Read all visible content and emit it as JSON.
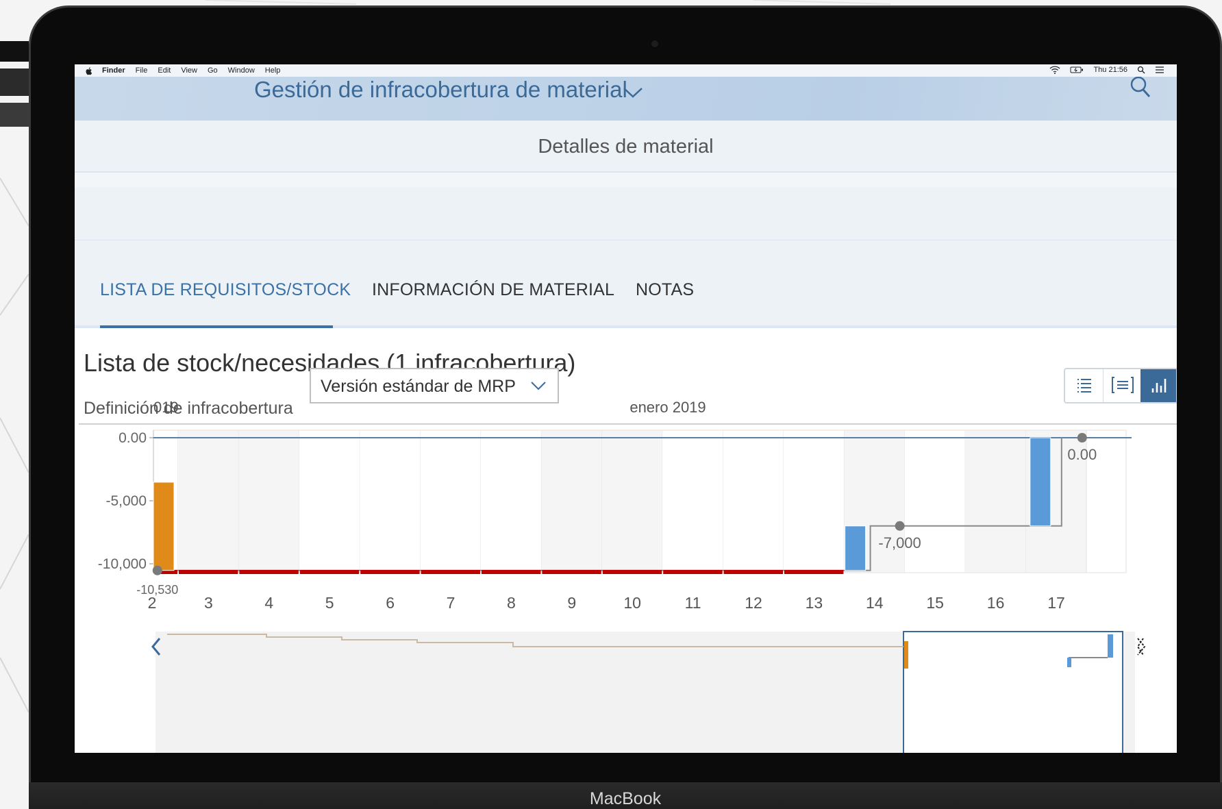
{
  "device": {
    "brand": "MacBook"
  },
  "menubar": {
    "app": "Finder",
    "items": [
      "File",
      "Edit",
      "View",
      "Go",
      "Window",
      "Help"
    ],
    "clock": "Thu 21:56"
  },
  "shell": {
    "title": "Gestión de infracobertura de material"
  },
  "object_header": {
    "title": "Detalles de material"
  },
  "tabs": [
    {
      "label": "LISTA DE REQUISITOS/STOCK",
      "active": true
    },
    {
      "label": "INFORMACIÓN DE MATERIAL",
      "active": false
    },
    {
      "label": "NOTAS",
      "active": false
    }
  ],
  "list": {
    "title": "Lista de stock/necesidades (1 infracobertura)",
    "definition_label": "Definición de infracobertura",
    "definition_value": "Versión estándar de MRP"
  },
  "view_switch": {
    "options": [
      "list-icon",
      "detail-list-icon",
      "chart-icon"
    ],
    "selected": "chart-icon"
  },
  "colors": {
    "accent": "#3b6a99",
    "receipt": "#5a9ad8",
    "issue": "#e08a1a",
    "shortage": "#bb0000",
    "line": "#5a7fa6"
  },
  "chart_data": {
    "type": "waterfall",
    "period_labels": [
      "019",
      "enero 2019"
    ],
    "y_ticks": [
      "0.00",
      "-5,000",
      "-10,000"
    ],
    "ylim": [
      -11000,
      500
    ],
    "x_tick_labels": [
      "2",
      "3",
      "4",
      "5",
      "6",
      "7",
      "8",
      "9",
      "10",
      "11",
      "12",
      "13",
      "14",
      "15",
      "16",
      "17"
    ],
    "x_days": [
      2,
      3,
      4,
      5,
      6,
      7,
      8,
      9,
      10,
      11,
      12,
      13,
      14,
      15,
      16,
      17
    ],
    "bars": [
      {
        "day": 2,
        "from": -3530,
        "to": -10530,
        "kind": "issue"
      },
      {
        "day": 14,
        "from": -10530,
        "to": -7000,
        "kind": "receipt"
      },
      {
        "day": 17,
        "from": -7000,
        "to": 0,
        "kind": "receipt"
      }
    ],
    "balance_points": [
      {
        "day": 2,
        "value": -10530,
        "label": "-10,530"
      },
      {
        "day": 14,
        "value": -7000,
        "label": "-7,000"
      },
      {
        "day": 17,
        "value": 0,
        "label": "0.00"
      }
    ],
    "shortage_range": [
      2,
      13
    ],
    "grid": true
  }
}
